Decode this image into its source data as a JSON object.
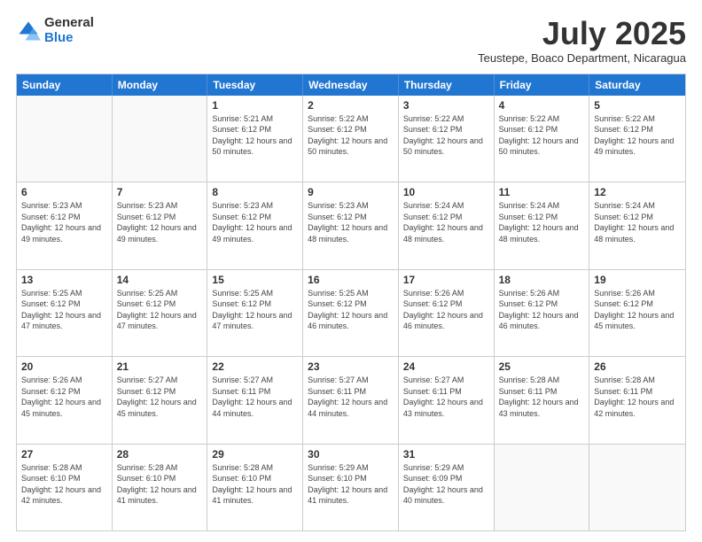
{
  "logo": {
    "general": "General",
    "blue": "Blue"
  },
  "title": "July 2025",
  "subtitle": "Teustepe, Boaco Department, Nicaragua",
  "header_days": [
    "Sunday",
    "Monday",
    "Tuesday",
    "Wednesday",
    "Thursday",
    "Friday",
    "Saturday"
  ],
  "weeks": [
    [
      {
        "day": "",
        "info": ""
      },
      {
        "day": "",
        "info": ""
      },
      {
        "day": "1",
        "sunrise": "5:21 AM",
        "sunset": "6:12 PM",
        "daylight": "12 hours and 50 minutes."
      },
      {
        "day": "2",
        "sunrise": "5:22 AM",
        "sunset": "6:12 PM",
        "daylight": "12 hours and 50 minutes."
      },
      {
        "day": "3",
        "sunrise": "5:22 AM",
        "sunset": "6:12 PM",
        "daylight": "12 hours and 50 minutes."
      },
      {
        "day": "4",
        "sunrise": "5:22 AM",
        "sunset": "6:12 PM",
        "daylight": "12 hours and 50 minutes."
      },
      {
        "day": "5",
        "sunrise": "5:22 AM",
        "sunset": "6:12 PM",
        "daylight": "12 hours and 49 minutes."
      }
    ],
    [
      {
        "day": "6",
        "sunrise": "5:23 AM",
        "sunset": "6:12 PM",
        "daylight": "12 hours and 49 minutes."
      },
      {
        "day": "7",
        "sunrise": "5:23 AM",
        "sunset": "6:12 PM",
        "daylight": "12 hours and 49 minutes."
      },
      {
        "day": "8",
        "sunrise": "5:23 AM",
        "sunset": "6:12 PM",
        "daylight": "12 hours and 49 minutes."
      },
      {
        "day": "9",
        "sunrise": "5:23 AM",
        "sunset": "6:12 PM",
        "daylight": "12 hours and 48 minutes."
      },
      {
        "day": "10",
        "sunrise": "5:24 AM",
        "sunset": "6:12 PM",
        "daylight": "12 hours and 48 minutes."
      },
      {
        "day": "11",
        "sunrise": "5:24 AM",
        "sunset": "6:12 PM",
        "daylight": "12 hours and 48 minutes."
      },
      {
        "day": "12",
        "sunrise": "5:24 AM",
        "sunset": "6:12 PM",
        "daylight": "12 hours and 48 minutes."
      }
    ],
    [
      {
        "day": "13",
        "sunrise": "5:25 AM",
        "sunset": "6:12 PM",
        "daylight": "12 hours and 47 minutes."
      },
      {
        "day": "14",
        "sunrise": "5:25 AM",
        "sunset": "6:12 PM",
        "daylight": "12 hours and 47 minutes."
      },
      {
        "day": "15",
        "sunrise": "5:25 AM",
        "sunset": "6:12 PM",
        "daylight": "12 hours and 47 minutes."
      },
      {
        "day": "16",
        "sunrise": "5:25 AM",
        "sunset": "6:12 PM",
        "daylight": "12 hours and 46 minutes."
      },
      {
        "day": "17",
        "sunrise": "5:26 AM",
        "sunset": "6:12 PM",
        "daylight": "12 hours and 46 minutes."
      },
      {
        "day": "18",
        "sunrise": "5:26 AM",
        "sunset": "6:12 PM",
        "daylight": "12 hours and 46 minutes."
      },
      {
        "day": "19",
        "sunrise": "5:26 AM",
        "sunset": "6:12 PM",
        "daylight": "12 hours and 45 minutes."
      }
    ],
    [
      {
        "day": "20",
        "sunrise": "5:26 AM",
        "sunset": "6:12 PM",
        "daylight": "12 hours and 45 minutes."
      },
      {
        "day": "21",
        "sunrise": "5:27 AM",
        "sunset": "6:12 PM",
        "daylight": "12 hours and 45 minutes."
      },
      {
        "day": "22",
        "sunrise": "5:27 AM",
        "sunset": "6:11 PM",
        "daylight": "12 hours and 44 minutes."
      },
      {
        "day": "23",
        "sunrise": "5:27 AM",
        "sunset": "6:11 PM",
        "daylight": "12 hours and 44 minutes."
      },
      {
        "day": "24",
        "sunrise": "5:27 AM",
        "sunset": "6:11 PM",
        "daylight": "12 hours and 43 minutes."
      },
      {
        "day": "25",
        "sunrise": "5:28 AM",
        "sunset": "6:11 PM",
        "daylight": "12 hours and 43 minutes."
      },
      {
        "day": "26",
        "sunrise": "5:28 AM",
        "sunset": "6:11 PM",
        "daylight": "12 hours and 42 minutes."
      }
    ],
    [
      {
        "day": "27",
        "sunrise": "5:28 AM",
        "sunset": "6:10 PM",
        "daylight": "12 hours and 42 minutes."
      },
      {
        "day": "28",
        "sunrise": "5:28 AM",
        "sunset": "6:10 PM",
        "daylight": "12 hours and 41 minutes."
      },
      {
        "day": "29",
        "sunrise": "5:28 AM",
        "sunset": "6:10 PM",
        "daylight": "12 hours and 41 minutes."
      },
      {
        "day": "30",
        "sunrise": "5:29 AM",
        "sunset": "6:10 PM",
        "daylight": "12 hours and 41 minutes."
      },
      {
        "day": "31",
        "sunrise": "5:29 AM",
        "sunset": "6:09 PM",
        "daylight": "12 hours and 40 minutes."
      },
      {
        "day": "",
        "info": ""
      },
      {
        "day": "",
        "info": ""
      }
    ]
  ]
}
